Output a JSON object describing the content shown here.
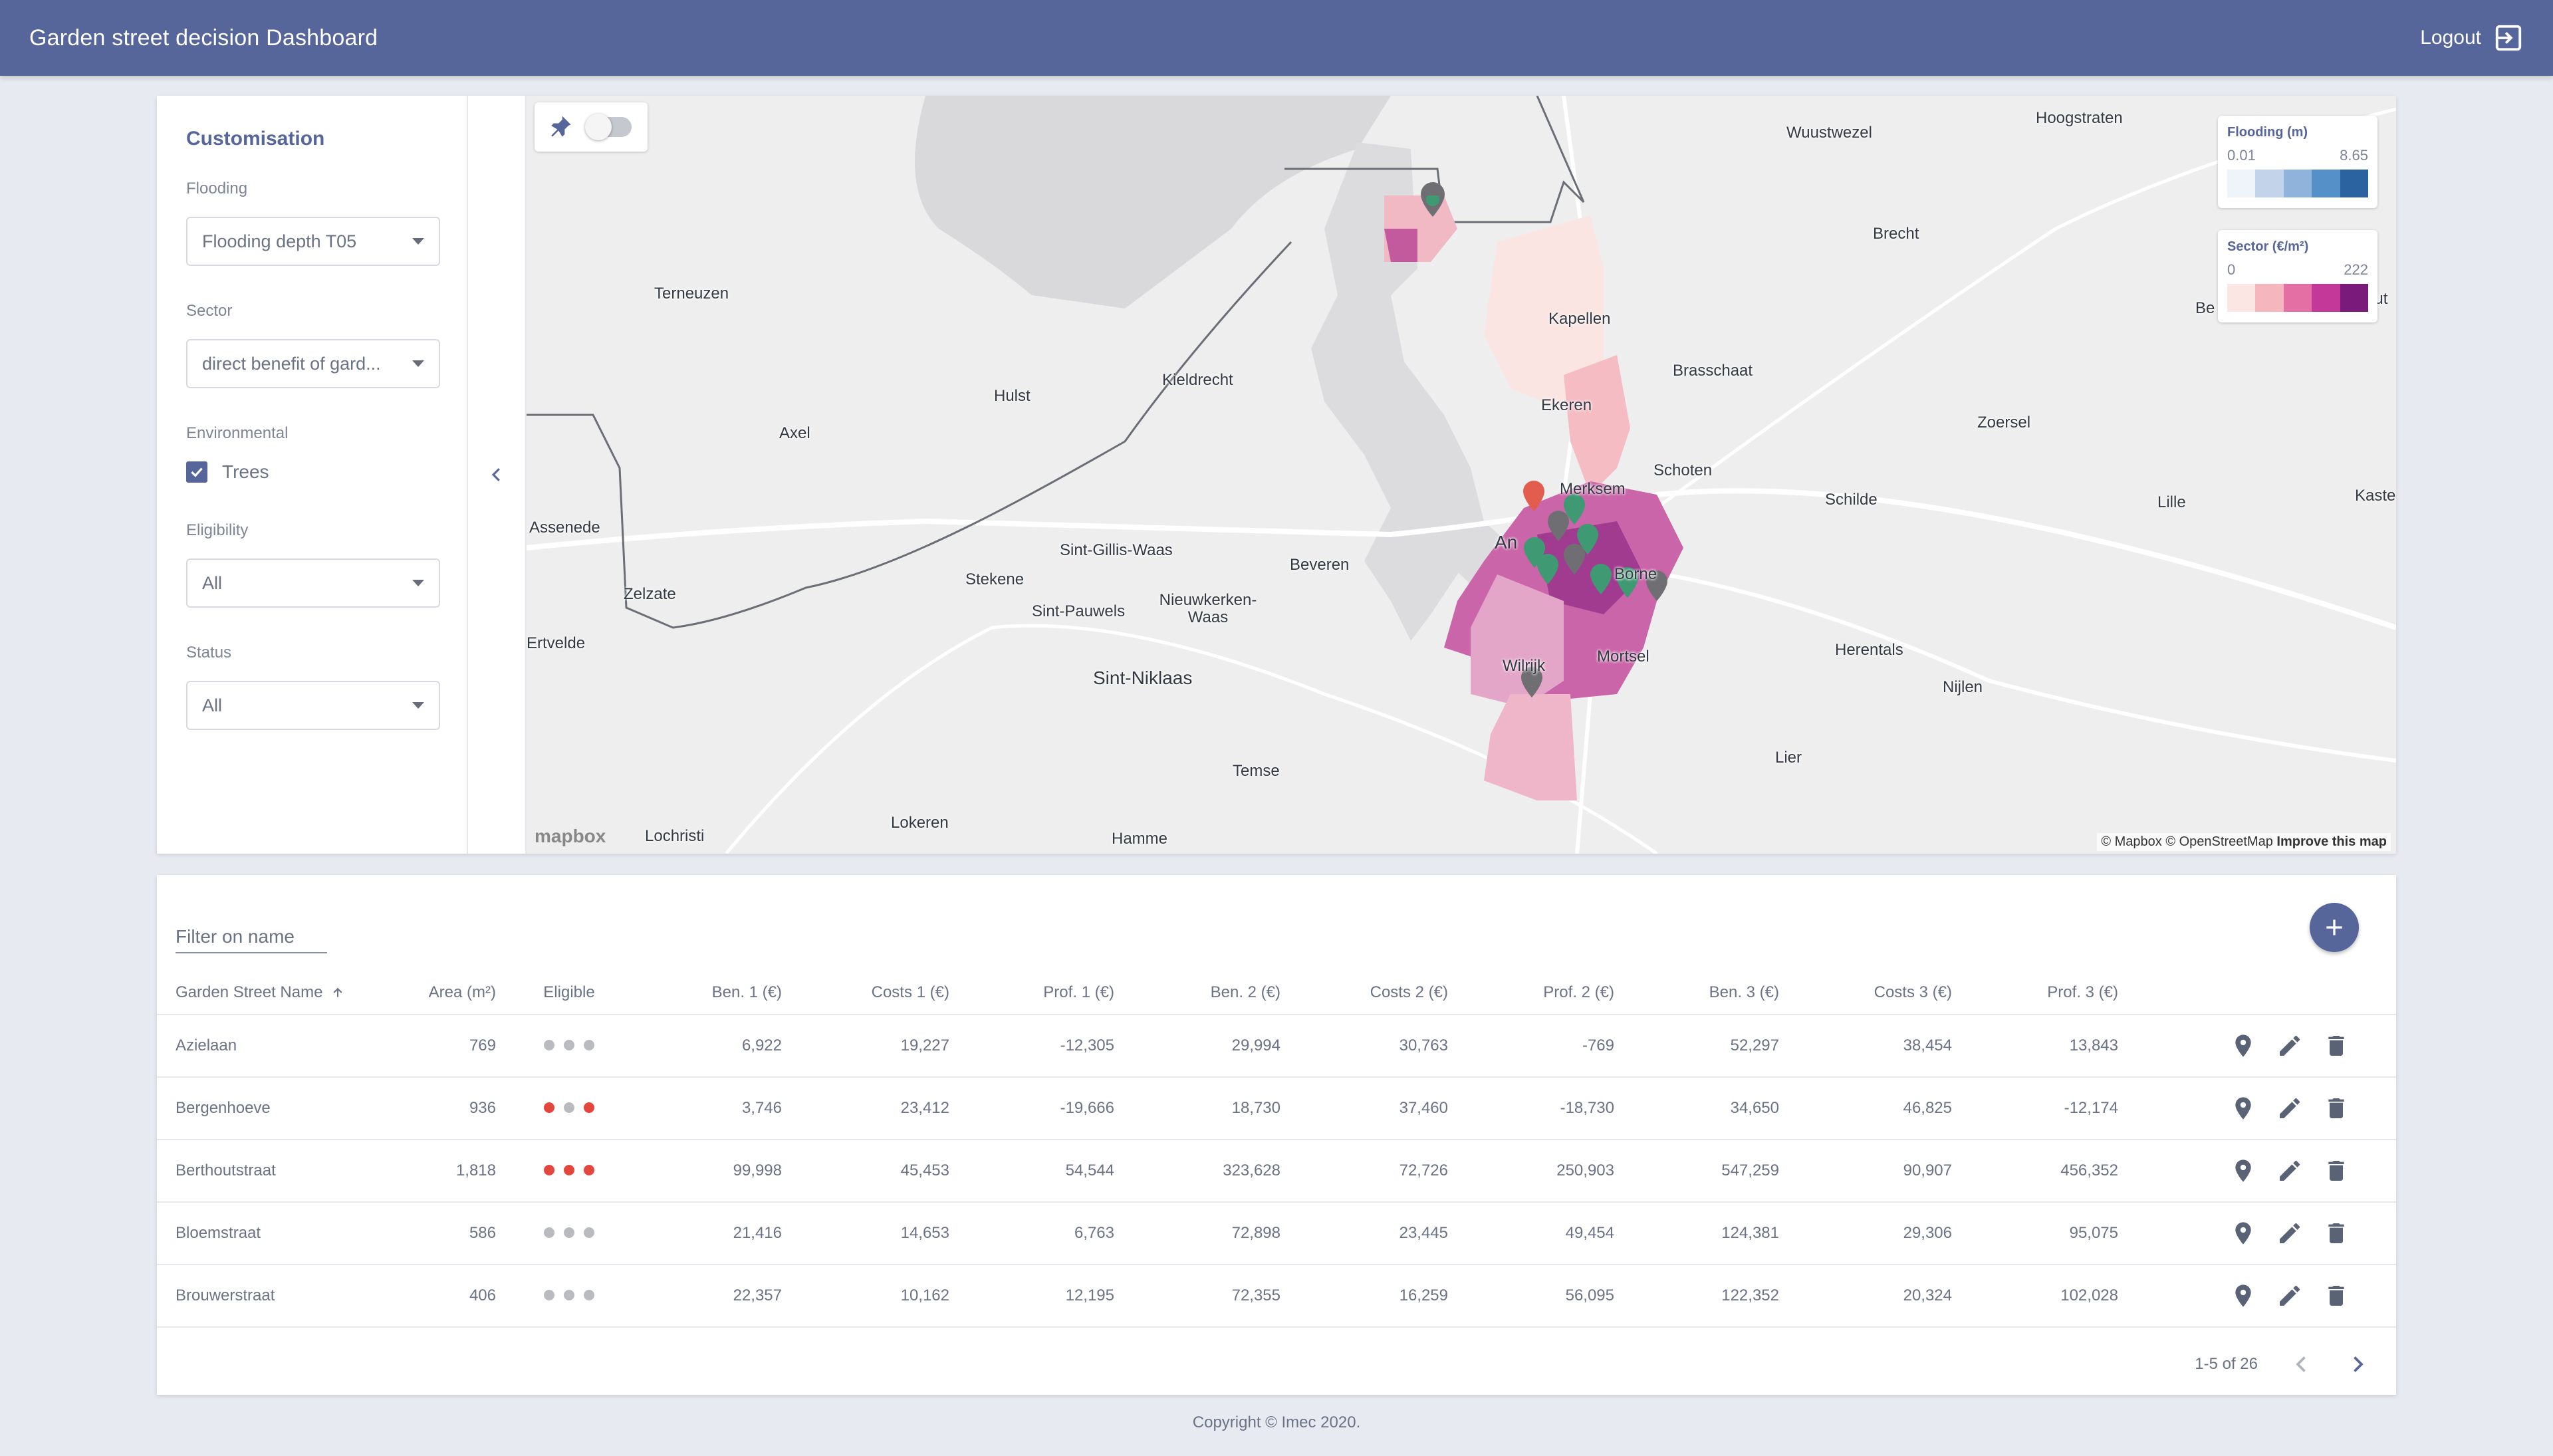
{
  "header": {
    "title": "Garden street decision Dashboard",
    "logout_label": "Logout"
  },
  "panel": {
    "title": "Customisation",
    "flooding_label": "Flooding",
    "flooding_value": "Flooding depth T05",
    "sector_label": "Sector",
    "sector_value": "direct benefit of gard...",
    "environmental_label": "Environmental",
    "trees_label": "Trees",
    "trees_checked": true,
    "eligibility_label": "Eligibility",
    "eligibility_value": "All",
    "status_label": "Status",
    "status_value": "All"
  },
  "map": {
    "legend_flooding": {
      "title": "Flooding (m)",
      "min": "0.01",
      "max": "8.65",
      "colors": [
        "#eff3fa",
        "#c3d3ea",
        "#8fb3da",
        "#5591c8",
        "#2b63a0"
      ]
    },
    "legend_sector": {
      "title": "Sector (€/m²)",
      "min": "0",
      "max": "222",
      "colors": [
        "#fce6e4",
        "#f5b6bd",
        "#e46fa4",
        "#c33899",
        "#7a1a7b"
      ]
    },
    "places": [
      "Wuustwezel",
      "Hoogstraten",
      "Brecht",
      "Terneuzen",
      "Kapellen",
      "Brasschaat",
      "Hulst",
      "Kieldrecht",
      "Ekeren",
      "Zoersel",
      "Axel",
      "Schoten",
      "Merksem",
      "Schilde",
      "Lille",
      "Kaste",
      "Assenede",
      "Sint-Gillis-Waas",
      "Stekene",
      "Beveren",
      "An",
      "Borne",
      "Zelzate",
      "Nieuwkerken-Waas",
      "Sint-Pauwels",
      "Ertvelde",
      "Wilrijk",
      "Mortsel",
      "Herentals",
      "Sint-Niklaas",
      "Nijlen",
      "Lier",
      "Temse",
      "Lokeren",
      "Hamme",
      "Lochristi",
      "Be",
      "out"
    ],
    "attribution_1": "© Mapbox © OpenStreetMap",
    "attribution_2": "Improve this map",
    "logo": "mapbox"
  },
  "table": {
    "filter_placeholder": "Filter on name",
    "columns": [
      "Garden Street Name",
      "Area (m²)",
      "Eligible",
      "Ben. 1 (€)",
      "Costs 1 (€)",
      "Prof. 1 (€)",
      "Ben. 2 (€)",
      "Costs 2 (€)",
      "Prof. 2 (€)",
      "Ben. 3 (€)",
      "Costs 3 (€)",
      "Prof. 3 (€)"
    ],
    "rows": [
      {
        "name": "Azielaan",
        "area": "769",
        "eligible": [
          "grey",
          "grey",
          "grey"
        ],
        "ben1": "6,922",
        "costs1": "19,227",
        "prof1": "-12,305",
        "ben2": "29,994",
        "costs2": "30,763",
        "prof2": "-769",
        "ben3": "52,297",
        "costs3": "38,454",
        "prof3": "13,843"
      },
      {
        "name": "Bergenhoeve",
        "area": "936",
        "eligible": [
          "red",
          "grey",
          "red"
        ],
        "ben1": "3,746",
        "costs1": "23,412",
        "prof1": "-19,666",
        "ben2": "18,730",
        "costs2": "37,460",
        "prof2": "-18,730",
        "ben3": "34,650",
        "costs3": "46,825",
        "prof3": "-12,174"
      },
      {
        "name": "Berthoutstraat",
        "area": "1,818",
        "eligible": [
          "red",
          "red",
          "red"
        ],
        "ben1": "99,998",
        "costs1": "45,453",
        "prof1": "54,544",
        "ben2": "323,628",
        "costs2": "72,726",
        "prof2": "250,903",
        "ben3": "547,259",
        "costs3": "90,907",
        "prof3": "456,352"
      },
      {
        "name": "Bloemstraat",
        "area": "586",
        "eligible": [
          "grey",
          "grey",
          "grey"
        ],
        "ben1": "21,416",
        "costs1": "14,653",
        "prof1": "6,763",
        "ben2": "72,898",
        "costs2": "23,445",
        "prof2": "49,454",
        "ben3": "124,381",
        "costs3": "29,306",
        "prof3": "95,075"
      },
      {
        "name": "Brouwerstraat",
        "area": "406",
        "eligible": [
          "grey",
          "grey",
          "grey"
        ],
        "ben1": "22,357",
        "costs1": "10,162",
        "prof1": "12,195",
        "ben2": "72,355",
        "costs2": "16,259",
        "prof2": "56,095",
        "ben3": "122,352",
        "costs3": "20,324",
        "prof3": "102,028"
      }
    ],
    "pagination": "1-5 of 26"
  },
  "colors": {
    "primary": "#56659a",
    "dot_red": "#e3463c",
    "dot_grey": "#b9bbc1",
    "marker_green": "#3f9a73",
    "marker_red": "#e35d4f",
    "marker_grey": "#6f6f73"
  },
  "footer": "Copyright © Imec 2020."
}
